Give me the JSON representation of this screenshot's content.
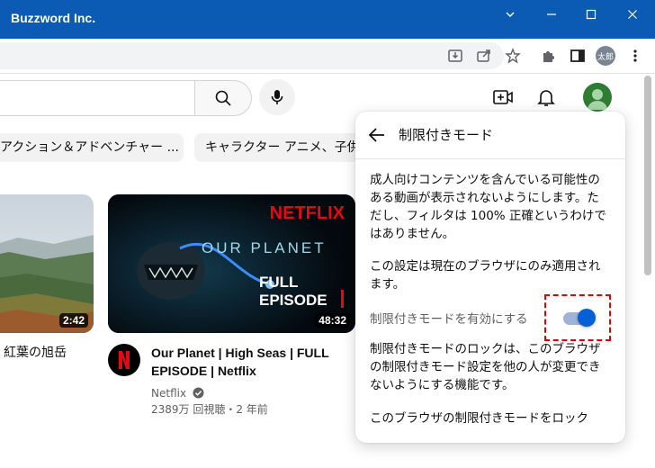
{
  "window": {
    "title": "Buzzword Inc."
  },
  "toolbar": {
    "profile_label": "太郎"
  },
  "chips": [
    "アクション＆アドベンチャー ...",
    "キャラクター アニメ、子供"
  ],
  "videos": [
    {
      "title_line1": "紅葉の旭岳",
      "duration": "2:42"
    },
    {
      "title_line1": "Our Planet | High Seas | FULL",
      "title_line2": "EPISODE | Netflix",
      "channel": "Netflix",
      "meta": "2389万 回視聴・2 年前",
      "duration": "48:32",
      "thumb_brand": "NETFLIX",
      "thumb_title": "OUR PLANET",
      "thumb_full": "FULL",
      "thumb_episode": "EPISODE"
    }
  ],
  "panel": {
    "title": "制限付きモード",
    "para1_l1": "成人向けコンテンツを含んでいる可能性の",
    "para1_l2": "ある動画が表示されないようにします。た",
    "para1_l3": "だし、フィルタは 100% 正確というわけで",
    "para1_l4": "はありません。",
    "para2_l1": "この設定は現在のブラウザにのみ適用され",
    "para2_l2": "ます。",
    "toggle_label": "制限付きモードを有効にする",
    "toggle_on": true,
    "para3_l1": "制限付きモードのロックは、このブラウザ",
    "para3_l2": "の制限付きモード設定を他の人が変更でき",
    "para3_l3": "ないようにする機能です。",
    "lock_link": "このブラウザの制限付きモードをロック"
  },
  "colors": {
    "titlebar": "#0b5bb5",
    "toggle_accent": "#065fd4",
    "highlight": "#e00000"
  }
}
